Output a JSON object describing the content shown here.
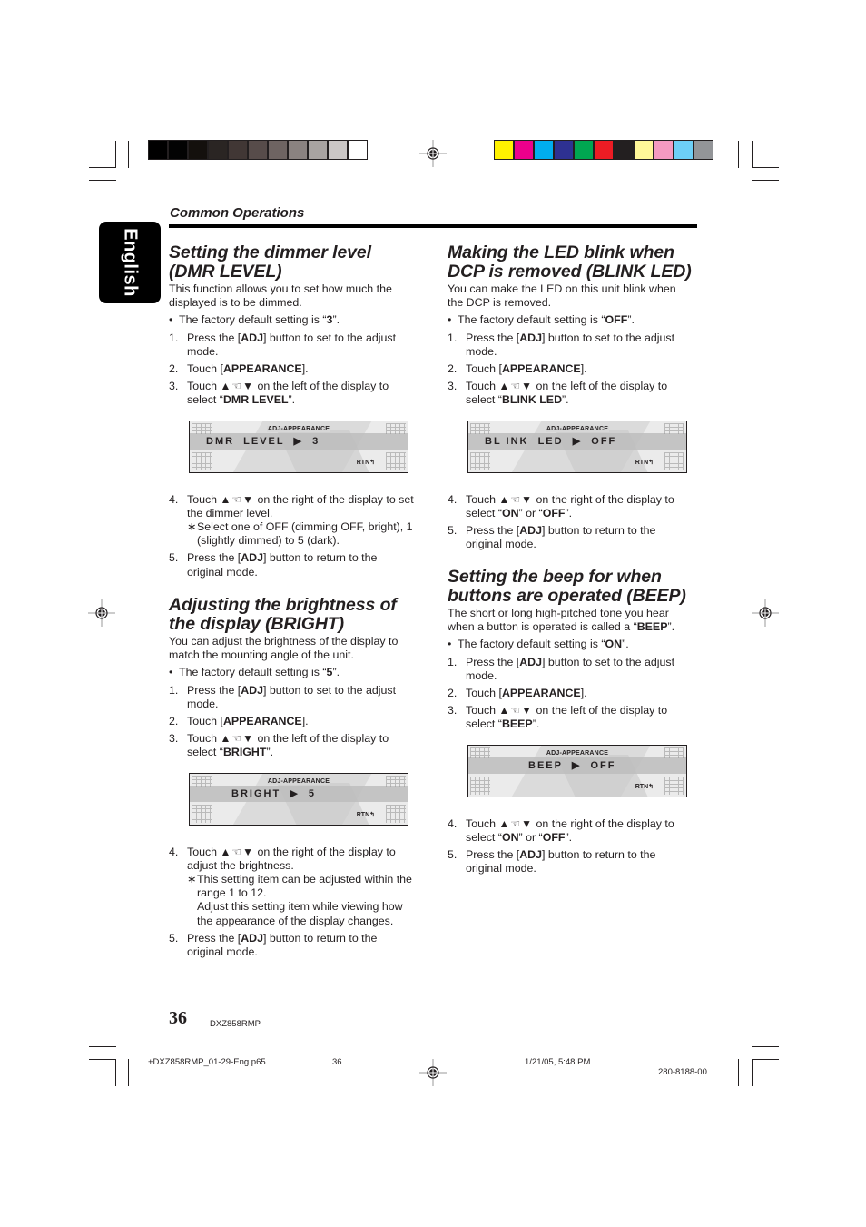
{
  "print_marks": {
    "grayscale_swatches": [
      "#000000",
      "#030303",
      "#14100d",
      "#2a2523",
      "#413735",
      "#574c4a",
      "#6e6462",
      "#8a8280",
      "#a8a3a1",
      "#cbc7c6",
      "#ffffff"
    ],
    "color_swatches": [
      "#fff200",
      "#ec008c",
      "#00aeef",
      "#2e3192",
      "#00a651",
      "#ed1c24",
      "#231f20",
      "#fff799",
      "#f49ac1",
      "#6dcff6",
      "#939598"
    ]
  },
  "language_tab": "English",
  "section_header": "Common Operations",
  "icons": {
    "touch_arrows": "up-hand-down-arrows-icon"
  },
  "sections": {
    "dimmer": {
      "title_line1": "Setting the dimmer level",
      "title_line2": "(DMR LEVEL)",
      "intro": "This function allows you to set how much the displayed is to be dimmed.",
      "default_prefix": "The factory default setting is “",
      "default_value": "3",
      "default_suffix": "”.",
      "step1": {
        "num": "1.",
        "pre": "Press the [",
        "bold": "ADJ",
        "post": "] button to set to the adjust mode."
      },
      "step2": {
        "num": "2.",
        "pre": "Touch [",
        "bold": "APPEARANCE",
        "post": "]."
      },
      "step3": {
        "num": "3.",
        "pre": "Touch",
        "mid": " on the left of the display to select “",
        "bold": "DMR LEVEL",
        "post": "”."
      },
      "display": {
        "title": "ADJ-APPEARANCE",
        "item": "DMR  LEVEL",
        "value": "3",
        "rtn": "RTN"
      },
      "step4": {
        "num": "4.",
        "pre": "Touch",
        "post": " on the right of the display to set the dimmer level."
      },
      "note": "Select one of OFF (dimming OFF, bright), 1 (slightly dimmed) to 5 (dark).",
      "step5": {
        "num": "5.",
        "pre": "Press the [",
        "bold": "ADJ",
        "post": "] button to return to the original mode."
      }
    },
    "bright": {
      "title_line1": "Adjusting the brightness of",
      "title_line2": "the display (BRIGHT)",
      "intro": "You can adjust the brightness of the display to match the mounting angle of the unit.",
      "default_prefix": "The factory default setting is “",
      "default_value": "5",
      "default_suffix": "”.",
      "step1": {
        "num": "1.",
        "pre": "Press the [",
        "bold": "ADJ",
        "post": "] button to set to the adjust mode."
      },
      "step2": {
        "num": "2.",
        "pre": "Touch [",
        "bold": "APPEARANCE",
        "post": "]."
      },
      "step3": {
        "num": "3.",
        "pre": "Touch",
        "mid": " on the left of the display to select “",
        "bold": "BRIGHT",
        "post": "”."
      },
      "display": {
        "title": "ADJ-APPEARANCE",
        "item": "BRIGHT",
        "value": "5",
        "rtn": "RTN"
      },
      "step4": {
        "num": "4.",
        "pre": "Touch",
        "post": " on the right of the display to adjust the brightness."
      },
      "note": "This setting item can be adjusted within the range 1 to 12.",
      "note2": "Adjust this setting item while viewing how the appearance of the display changes.",
      "step5": {
        "num": "5.",
        "pre": "Press the [",
        "bold": "ADJ",
        "post": "] button to return to the original mode."
      }
    },
    "blink": {
      "title_line1": "Making the LED blink when",
      "title_line2": "DCP is removed (BLINK LED)",
      "intro": "You can make the LED on this unit blink when the DCP is removed.",
      "default_prefix": "The factory default setting is “",
      "default_value": "OFF",
      "default_suffix": "”.",
      "step1": {
        "num": "1.",
        "pre": "Press the [",
        "bold": "ADJ",
        "post": "] button to set to the adjust mode."
      },
      "step2": {
        "num": "2.",
        "pre": "Touch [",
        "bold": "APPEARANCE",
        "post": "]."
      },
      "step3": {
        "num": "3.",
        "pre": "Touch",
        "mid": " on the left of the display to select “",
        "bold": "BLINK LED",
        "post": "”."
      },
      "display": {
        "title": "ADJ-APPEARANCE",
        "item": "BL INK  LED",
        "value": "OFF",
        "rtn": "RTN"
      },
      "step4": {
        "num": "4.",
        "pre": "Touch",
        "mid": " on the right of the display to select “",
        "bold1": "ON",
        "or": "” or “",
        "bold2": "OFF",
        "post": "”."
      },
      "step5": {
        "num": "5.",
        "pre": "Press the [",
        "bold": "ADJ",
        "post": "] button to return to the original mode."
      }
    },
    "beep": {
      "title_line1": "Setting the beep for when",
      "title_line2": "buttons are operated (BEEP)",
      "intro_pre": "The short or long high-pitched tone you hear when a button is operated is called a “",
      "intro_bold": "BEEP",
      "intro_post": "”.",
      "default_prefix": "The factory default setting is “",
      "default_value": "ON",
      "default_suffix": "”.",
      "step1": {
        "num": "1.",
        "pre": "Press the [",
        "bold": "ADJ",
        "post": "] button to set to the adjust mode."
      },
      "step2": {
        "num": "2.",
        "pre": "Touch [",
        "bold": "APPEARANCE",
        "post": "]."
      },
      "step3": {
        "num": "3.",
        "pre": "Touch",
        "mid": " on the left of the display to select “",
        "bold": "BEEP",
        "post": "”."
      },
      "display": {
        "title": "ADJ-APPEARANCE",
        "item": "BEEP",
        "value": "OFF",
        "rtn": "RTN"
      },
      "step4": {
        "num": "4.",
        "pre": "Touch",
        "mid": " on the right of the display to select “",
        "bold1": "ON",
        "or": "” or “",
        "bold2": "OFF",
        "post": "”."
      },
      "step5": {
        "num": "5.",
        "pre": "Press the [",
        "bold": "ADJ",
        "post": "] button to return to the original mode."
      }
    }
  },
  "footer": {
    "page_number": "36",
    "model": "DXZ858RMP",
    "slug_file": "+DXZ858RMP_01-29-Eng.p65",
    "slug_page": "36",
    "slug_date": "1/21/05, 5:48 PM",
    "slug_code": "280-8188-00"
  }
}
